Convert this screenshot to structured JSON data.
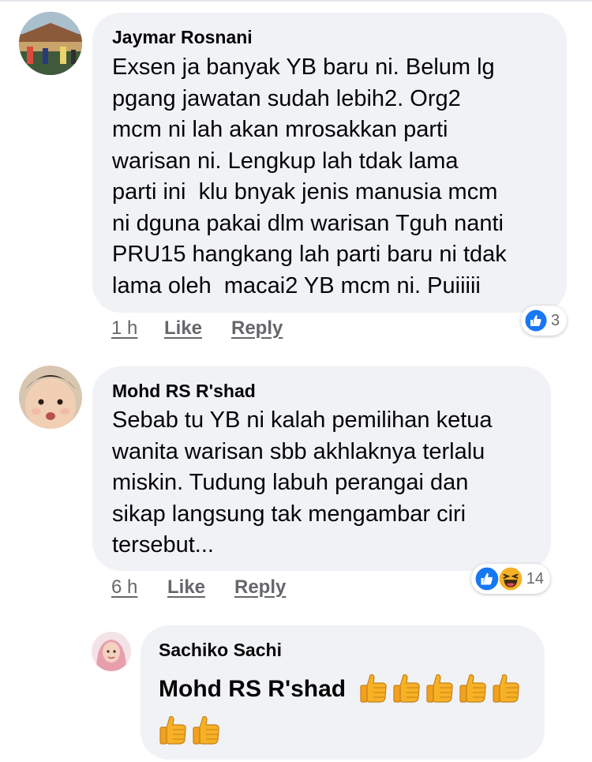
{
  "comments": [
    {
      "author": "Jaymar Rosnani",
      "lines": [
        "Exsen ja banyak YB baru ni. Belum lg",
        "pgang jawatan sudah lebih2. Org2",
        "mcm ni lah akan mrosakkan parti",
        "warisan ni. Lengkup lah tdak lama",
        "parti ini  klu bnyak jenis manusia mcm",
        "ni dguna pakai dlm warisan Tguh nanti",
        "PRU15 hangkang lah parti baru ni tdak",
        "lama oleh  macai2 YB mcm ni. Puiiiii"
      ],
      "time": "1 h",
      "like": "Like",
      "reply": "Reply",
      "reaction_count": "3",
      "reactions": [
        "like-icon"
      ]
    },
    {
      "author": "Mohd RS R'shad",
      "lines": [
        "Sebab tu YB ni kalah pemilihan ketua",
        "wanita warisan sbb akhlaknya terlalu",
        "miskin. Tudung labuh perangai dan",
        "sikap langsung tak mengambar ciri",
        "tersebut..."
      ],
      "time": "6 h",
      "like": "Like",
      "reply": "Reply",
      "reaction_count": "14",
      "reactions": [
        "like-icon",
        "haha-icon"
      ]
    },
    {
      "author": "Sachiko Sachi",
      "mention": "Mohd RS R'shad",
      "thumbs_up_count": 7
    }
  ],
  "colors": {
    "bubble": "#f0f2f5",
    "meta_text": "#65676b",
    "like_blue": "#1877f2",
    "haha_yellow": "#f7b125"
  }
}
